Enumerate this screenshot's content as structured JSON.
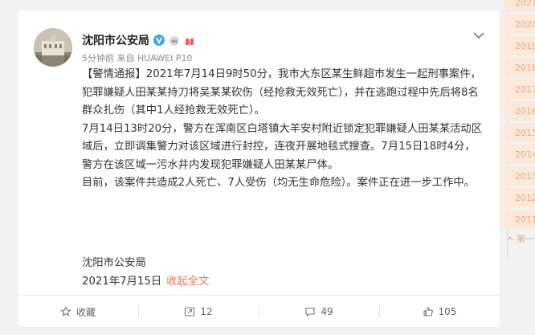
{
  "post": {
    "author": "沈阳市公安局",
    "meta": "5分钟前 来自 HUAWEI P10",
    "paragraphs": [
      "【警情通报】2021年7月14日9时50分，我市大东区某生鲜超市发生一起刑事案件，犯罪嫌疑人田某某持刀将吴某某砍伤（经抢救无效死亡），并在逃跑过程中先后将8名群众扎伤（其中1人经抢救无效死亡）。",
      "7月14日13时20分，警方在浑南区白塔镇大羊安村附近锁定犯罪嫌疑人田某某活动区域后，立即调集警力对该区域进行封控，连夜开展地毯式搜查。7月15日18时4分，警方在该区域一污水井内发现犯罪嫌疑人田某某尸体。",
      "目前，该案件共造成2人死亡、7人受伤（均无生命危险）。案件正在进一步工作中。"
    ],
    "signature": "沈阳市公安局",
    "date": "2021年7月15日",
    "collapse_label": "收起全文"
  },
  "actions": {
    "favorite_label": "收藏",
    "repost_count": "12",
    "comment_count": "49",
    "like_count": "105"
  },
  "timeline": {
    "years": [
      "2021",
      "2020",
      "2019",
      "2018",
      "2017",
      "2016",
      "2015",
      "2014",
      "2013",
      "2012",
      "2011"
    ],
    "more_label": "第一"
  },
  "colors": {
    "accent": "#eb7350",
    "verified": "#3ba6f4",
    "rail_bg": "#fde9d9",
    "rail_text": "#e7a989"
  },
  "icons": [
    "verified-badge-icon",
    "member-crown-icon",
    "vip-gift-icon",
    "chevron-down-icon",
    "star-icon",
    "repost-icon",
    "comment-icon",
    "like-icon"
  ]
}
